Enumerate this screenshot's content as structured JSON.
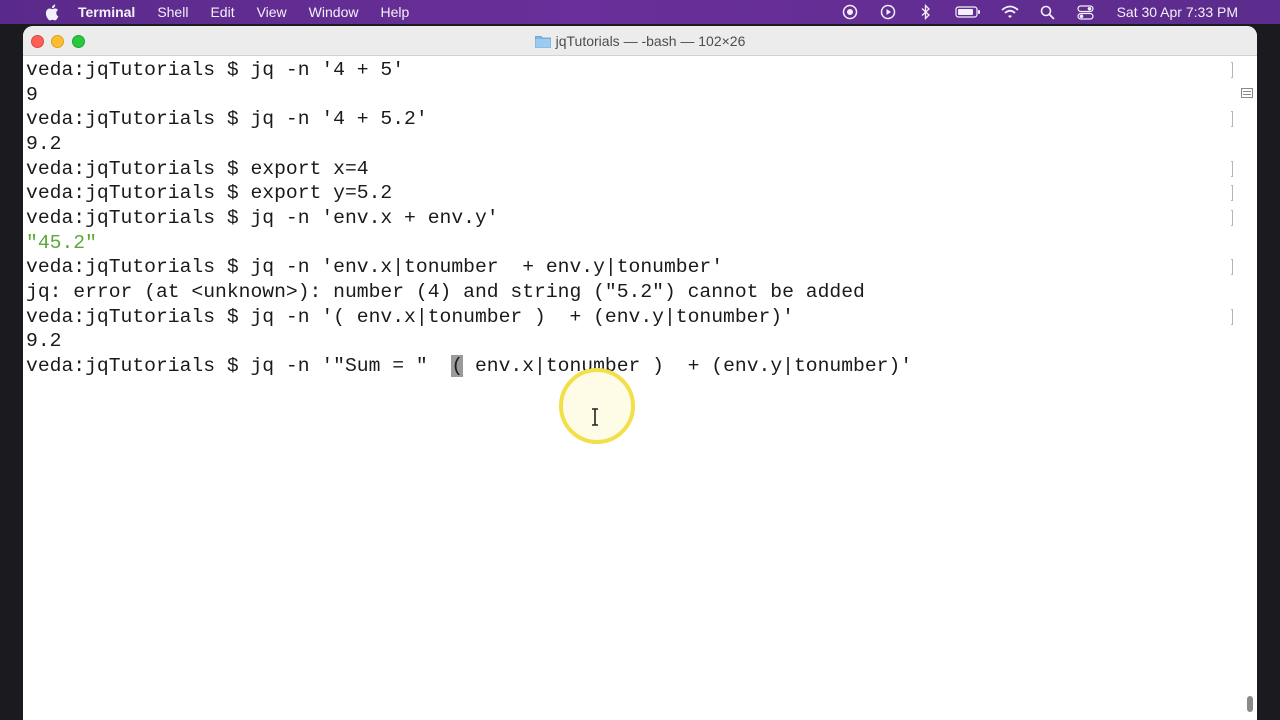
{
  "menubar": {
    "app_name": "Terminal",
    "items": [
      "Shell",
      "Edit",
      "View",
      "Window",
      "Help"
    ],
    "clock": "Sat 30 Apr  7:33 PM"
  },
  "window": {
    "title": "jqTutorials — -bash — 102×26"
  },
  "terminal": {
    "lines": [
      "veda:jqTutorials $ jq -n '4 + 5'",
      "9",
      "veda:jqTutorials $ jq -n '4 + 5.2'",
      "9.2",
      "veda:jqTutorials $ export x=4",
      "veda:jqTutorials $ export y=5.2",
      "veda:jqTutorials $ jq -n 'env.x + env.y'",
      "\"45.2\"",
      "veda:jqTutorials $ jq -n 'env.x|tonumber  + env.y|tonumber'",
      "jq: error (at <unknown>): number (4) and string (\"5.2\") cannot be added",
      "veda:jqTutorials $ jq -n '( env.x|tonumber )  + (env.y|tonumber)'",
      "9.2"
    ],
    "current_prompt_before": "veda:jqTutorials $ jq -n '\"Sum = \"  ",
    "current_prompt_selected": "(",
    "current_prompt_after": " env.x|tonumber )  + (env.y|tonumber)'"
  },
  "icons": {
    "apple": "apple-logo-icon",
    "record": "screen-record-icon",
    "play": "play-icon",
    "bluetooth": "bluetooth-icon",
    "battery": "battery-icon",
    "wifi": "wifi-icon",
    "search": "spotlight-search-icon",
    "control_center": "control-center-icon",
    "folder": "folder-icon"
  },
  "colors": {
    "menubar": "#5a2a8a",
    "string_output": "#59a838",
    "cursor_highlight": "#f1e04a"
  }
}
